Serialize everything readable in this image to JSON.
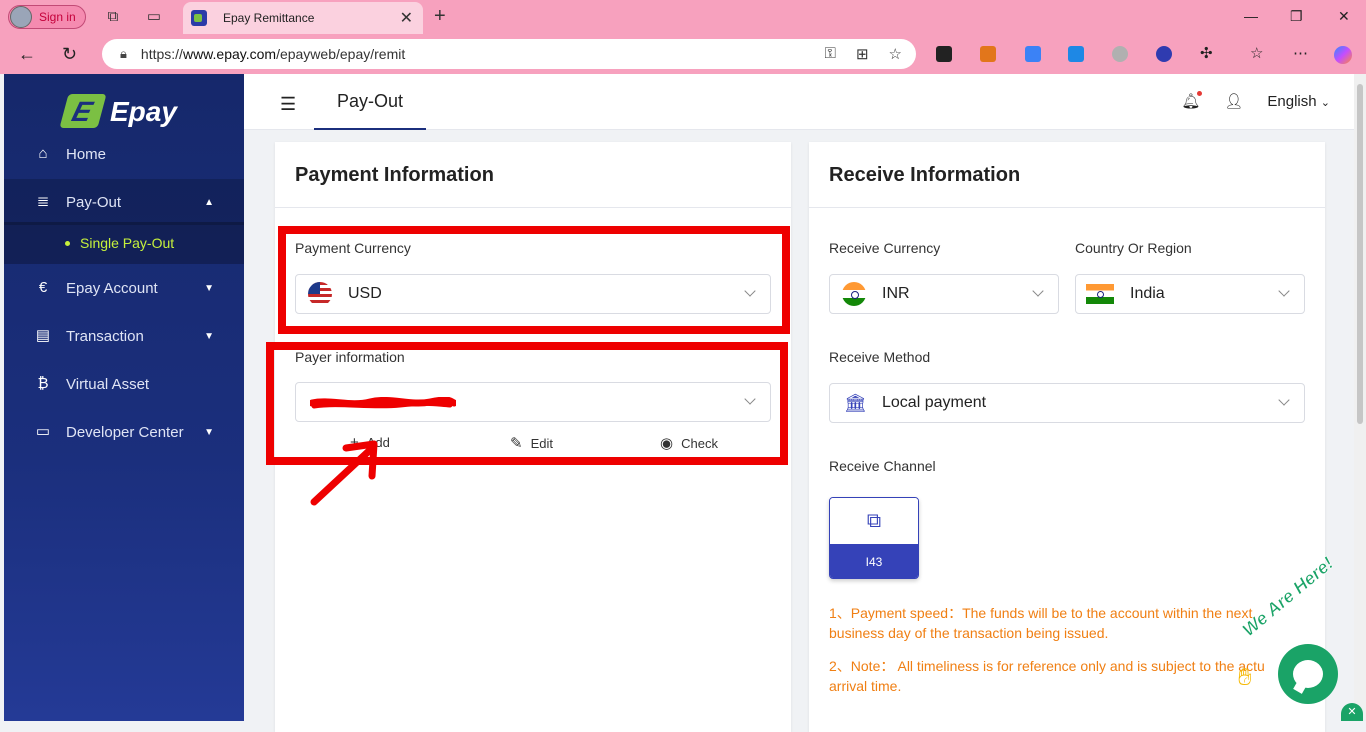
{
  "browser": {
    "profile_label": "Sign in",
    "tab_title": "Epay Remittance",
    "url_prefix": "https://",
    "url_domain": "www.epay.com",
    "url_path": "/epayweb/epay/remit"
  },
  "sidebar": {
    "logo_text": "Epay",
    "items": [
      {
        "label": "Home",
        "icon": "home-icon"
      },
      {
        "label": "Pay-Out",
        "icon": "payout-icon"
      },
      {
        "label": "Epay Account",
        "icon": "epay-account-icon"
      },
      {
        "label": "Transaction",
        "icon": "clipboard-icon"
      },
      {
        "label": "Virtual Asset",
        "icon": "bitcoin-icon"
      },
      {
        "label": "Developer Center",
        "icon": "monitor-icon"
      }
    ],
    "submenu_label": "Single Pay-Out"
  },
  "topbar": {
    "page_tab": "Pay-Out",
    "language": "English"
  },
  "payment": {
    "title": "Payment Information",
    "currency_label": "Payment Currency",
    "currency_value": "USD",
    "payer_label": "Payer information",
    "actions": {
      "add": "Add",
      "edit": "Edit",
      "check": "Check"
    }
  },
  "receive": {
    "title": "Receive Information",
    "currency_label": "Receive Currency",
    "currency_value": "INR",
    "country_label": "Country Or Region",
    "country_value": "India",
    "method_label": "Receive Method",
    "method_value": "Local payment",
    "channel_label": "Receive Channel",
    "channel_value": "I43",
    "note1": "1、Payment speed：The funds will be to the account within the next business day of the transaction being issued.",
    "note2": "2、Note： All timeliness is for reference only and is subject to the actu arrival time."
  },
  "chat": {
    "badge_text": "We Are Here!"
  },
  "colors": {
    "brand_navy": "#1b2f7d",
    "accent_green": "#c6f03c",
    "channel_blue": "#3542b8",
    "note_orange": "#f07f13",
    "highlight_red": "#ee0000",
    "chat_green": "#1aa367"
  }
}
